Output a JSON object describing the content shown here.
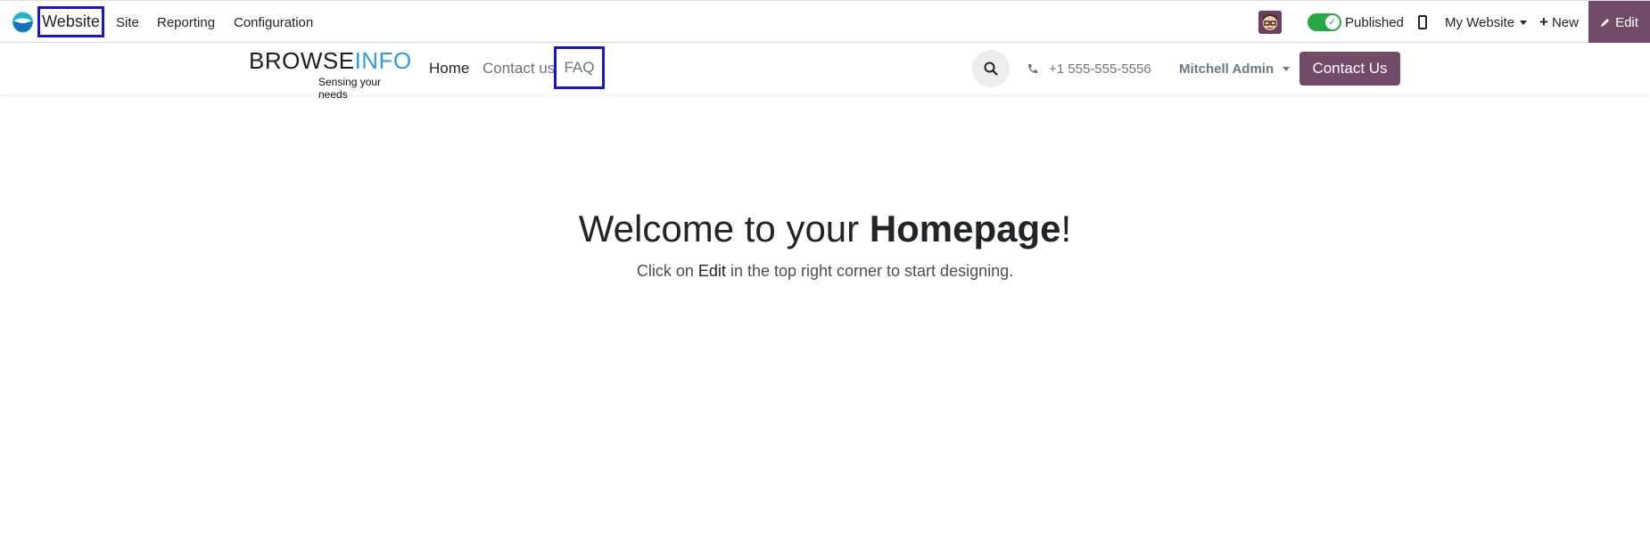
{
  "topbar": {
    "app_name": "Website",
    "menu": [
      "Site",
      "Reporting",
      "Configuration"
    ],
    "published_label": "Published",
    "website_selector": "My Website",
    "new_label": "New",
    "edit_label": "Edit",
    "published_on": true
  },
  "header": {
    "brand_word_1": "BROWSE",
    "brand_word_2": "INFO",
    "brand_tagline": "Sensing your needs",
    "nav": {
      "home": "Home",
      "contact": "Contact us",
      "faq": "FAQ"
    },
    "phone": "+1 555-555-5556",
    "user": "Mitchell Admin",
    "contact_button": "Contact Us"
  },
  "hero": {
    "title_prefix": "Welcome to your ",
    "title_bold": "Homepage",
    "title_suffix": "!",
    "sub_prefix": "Click on ",
    "sub_edit": "Edit",
    "sub_suffix": " in the top right corner to start designing."
  },
  "colors": {
    "brand_purple": "#714b67",
    "toggle_green": "#28a745",
    "highlight_blue": "#1515d6",
    "logo_blue": "#2f9ddb"
  },
  "icons": [
    "odoo-logo-icon",
    "avatar-icon",
    "check-icon",
    "mobile-icon",
    "plus-icon",
    "pencil-icon",
    "search-icon",
    "phone-icon"
  ]
}
